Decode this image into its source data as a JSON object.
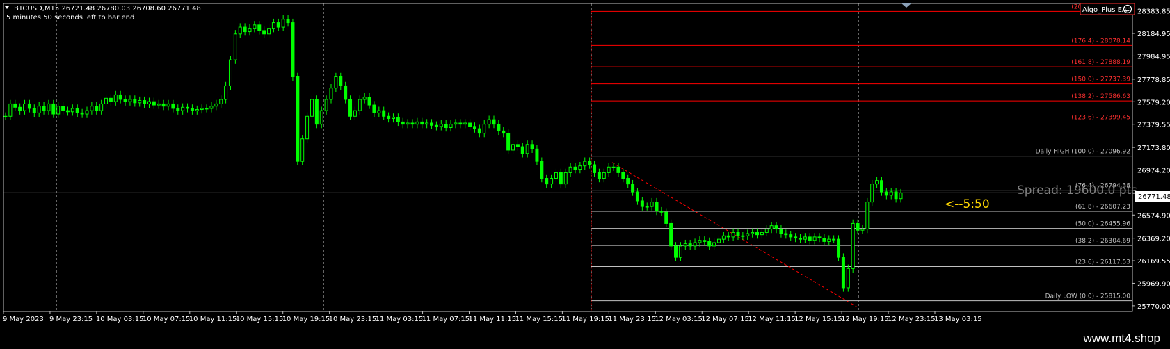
{
  "header": {
    "title": "BTCUSD,M15  26721.48 26780.03 26708.60 26771.48",
    "countdown": "5 minutes 50 seconds left to bar end"
  },
  "ea": {
    "label": "Algo_Plus EA"
  },
  "spread": {
    "text": "Spread: 19600.0 pts"
  },
  "timer": {
    "text": "<--5:50"
  },
  "current_price": "26771.48",
  "footer": {
    "url": "www.mt4.shop"
  },
  "colors": {
    "background": "#000000",
    "candle": "#00ff00",
    "resistance_line": "#ff0000",
    "support_line": "#c0c0c0",
    "axis_text": "#ffffff",
    "timer": "#ffd700",
    "spread": "#808080"
  },
  "fib_levels": [
    {
      "label": "(200.0) - 28380.00",
      "price": 28380.0,
      "kind": "upper"
    },
    {
      "label": "(176.4) - 28078.14",
      "price": 28078.14,
      "kind": "upper"
    },
    {
      "label": "(161.8) - 27888.19",
      "price": 27888.19,
      "kind": "upper"
    },
    {
      "label": "(150.0) - 27737.39",
      "price": 27737.39,
      "kind": "upper"
    },
    {
      "label": "(138.2) - 27586.63",
      "price": 27586.63,
      "kind": "upper"
    },
    {
      "label": "(123.6) - 27399.45",
      "price": 27399.45,
      "kind": "upper"
    },
    {
      "label": "Daily HIGH (100.0) - 27096.92",
      "price": 27096.92,
      "kind": "high"
    },
    {
      "label": "(76.4) - 26794.38",
      "price": 26794.38,
      "kind": "mid"
    },
    {
      "label": "(61.8) - 26607.23",
      "price": 26607.23,
      "kind": "mid"
    },
    {
      "label": "(50.0) - 26455.96",
      "price": 26455.96,
      "kind": "mid"
    },
    {
      "label": "(38.2) - 26304.69",
      "price": 26304.69,
      "kind": "mid"
    },
    {
      "label": "(23.6) - 26117.53",
      "price": 26117.53,
      "kind": "mid"
    },
    {
      "label": "Daily LOW (0.0) - 25815.00",
      "price": 25815.0,
      "kind": "low"
    }
  ],
  "chart_data": {
    "type": "line",
    "symbol": "BTCUSD",
    "timeframe": "M15",
    "ylim": [
      25720,
      28450
    ],
    "price_ticks": [
      "28383.85",
      "28184.95",
      "27984.95",
      "27778.85",
      "27579.20",
      "27379.55",
      "27173.80",
      "26974.20",
      "26771.48",
      "26574.90",
      "26369.20",
      "26169.55",
      "25969.90",
      "25770.00"
    ],
    "price_tick_values": [
      28383.85,
      28184.95,
      27984.95,
      27778.85,
      27579.2,
      27379.55,
      27173.8,
      26974.2,
      26771.48,
      26574.9,
      26369.2,
      26169.55,
      25969.9,
      25770.0
    ],
    "time_labels": [
      "9 May 2023",
      "9 May 23:15",
      "10 May 03:15",
      "10 May 07:15",
      "10 May 11:15",
      "10 May 15:15",
      "10 May 19:15",
      "10 May 23:15",
      "11 May 03:15",
      "11 May 07:15",
      "11 May 11:15",
      "11 May 15:15",
      "11 May 19:15",
      "11 May 23:15",
      "12 May 03:15",
      "12 May 07:15",
      "12 May 11:15",
      "12 May 15:15",
      "12 May 19:15",
      "12 May 23:15",
      "13 May 03:15"
    ],
    "series": [
      {
        "values": [
          27450,
          27560,
          27530,
          27500,
          27560,
          27520,
          27480,
          27540,
          27500,
          27560,
          27470,
          27540,
          27500,
          27490,
          27520,
          27480,
          27470,
          27500,
          27540,
          27500,
          27560,
          27610,
          27580,
          27640,
          27600,
          27580,
          27600,
          27570,
          27590,
          27560,
          27580,
          27550,
          27560,
          27540,
          27560,
          27520,
          27500,
          27530,
          27520,
          27500,
          27510,
          27520,
          27520,
          27540,
          27560,
          27600,
          27720,
          27950,
          28180,
          28240,
          28200,
          28230,
          28260,
          28210,
          28180,
          28230,
          28280,
          28240,
          28310,
          28280,
          27800,
          27050,
          27250,
          27450,
          27600,
          27380,
          27500,
          27600,
          27700,
          27800,
          27720,
          27600,
          27450,
          27500,
          27600,
          27620,
          27550,
          27480,
          27500,
          27450,
          27430,
          27440,
          27400,
          27380,
          27390,
          27380,
          27400,
          27380,
          27390,
          27370,
          27360,
          27380,
          27350,
          27380,
          27390,
          27380,
          27390,
          27360,
          27340,
          27300,
          27380,
          27420,
          27380,
          27320,
          27300,
          27150,
          27200,
          27180,
          27120,
          27200,
          27160,
          27050,
          26900,
          26850,
          26900,
          26950,
          26850,
          26950,
          27000,
          26980,
          27010,
          27050,
          27020,
          26950,
          26900,
          26950,
          27000,
          27000,
          26950,
          26900,
          26850,
          26780,
          26700,
          26650,
          26650,
          26690,
          26610,
          26600,
          26500,
          26300,
          26200,
          26300,
          26320,
          26300,
          26330,
          26350,
          26340,
          26300,
          26330,
          26360,
          26390,
          26380,
          26420,
          26390,
          26390,
          26410,
          26420,
          26400,
          26420,
          26450,
          26480,
          26450,
          26410,
          26400,
          26380,
          26370,
          26360,
          26380,
          26350,
          26380,
          26370,
          26340,
          26360,
          26360,
          26200,
          25930,
          26100,
          26500,
          26440,
          26450,
          26690,
          26850,
          26880,
          26780,
          26750,
          26780,
          26720,
          26770
        ]
      }
    ]
  }
}
